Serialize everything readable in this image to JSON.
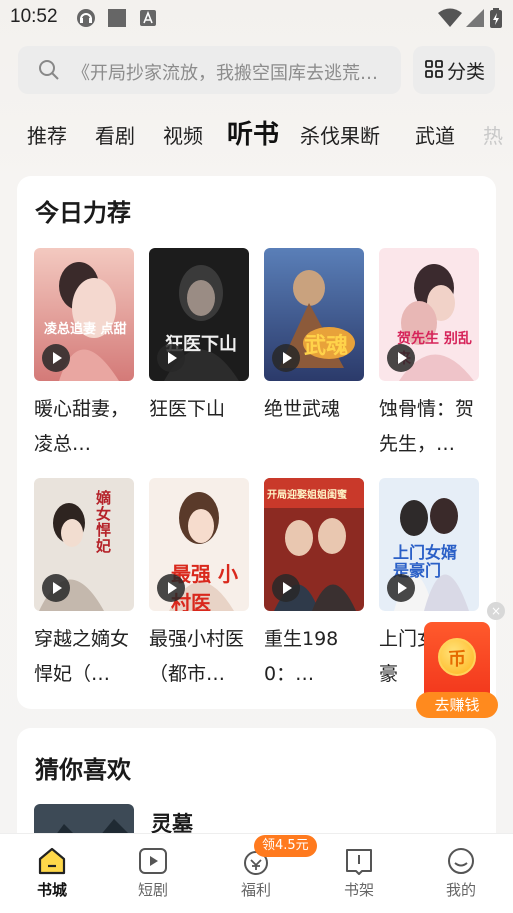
{
  "status_bar": {
    "time": "10:52"
  },
  "search": {
    "placeholder": "《开局抄家流放，我搬空国库去逃荒…"
  },
  "category_button": {
    "label": "分类"
  },
  "tabs": [
    {
      "label": "推荐"
    },
    {
      "label": "看剧"
    },
    {
      "label": "视频"
    },
    {
      "label": "听书"
    },
    {
      "label": "杀伐果断"
    },
    {
      "label": "武道"
    },
    {
      "label": "热"
    }
  ],
  "active_tab": "听书",
  "section_today": {
    "title": "今日力荐",
    "books": [
      {
        "title": "暖心甜妻，凌总…",
        "cover_text": "凌总追妻 点甜"
      },
      {
        "title": "狂医下山",
        "cover_text": "狂医下山"
      },
      {
        "title": "绝世武魂",
        "cover_text": "武魂"
      },
      {
        "title": "蚀骨情：贺先生，…",
        "cover_text": "贺先生 别乱来"
      },
      {
        "title": "穿越之嫡女悍妃（…",
        "cover_text": "嫡女悍妃"
      },
      {
        "title": "最强小村医（都市…",
        "cover_text": "最强 小村医"
      },
      {
        "title": "重生1980：…",
        "cover_text": "开局迎娶姐姐闺蜜"
      },
      {
        "title": "上门女婿是豪",
        "cover_text": "上门女婿 是豪门"
      }
    ]
  },
  "section_guess": {
    "title": "猜你喜欢",
    "books": [
      {
        "title": "灵墓"
      }
    ]
  },
  "earn_widget": {
    "label": "去赚钱",
    "close": "×",
    "coin_symbol": "币"
  },
  "bottom_nav": {
    "items": [
      {
        "label": "书城",
        "icon": "home-icon",
        "active": true
      },
      {
        "label": "短剧",
        "icon": "play-square-icon"
      },
      {
        "label": "福利",
        "icon": "gift-icon"
      },
      {
        "label": "书架",
        "icon": "bookshelf-icon"
      },
      {
        "label": "我的",
        "icon": "smile-icon"
      }
    ],
    "welfare_badge": "领4.5元"
  },
  "colors": {
    "accent": "#ff7a1e",
    "earn_red": "#f2361c",
    "nav_active": "#111111"
  }
}
